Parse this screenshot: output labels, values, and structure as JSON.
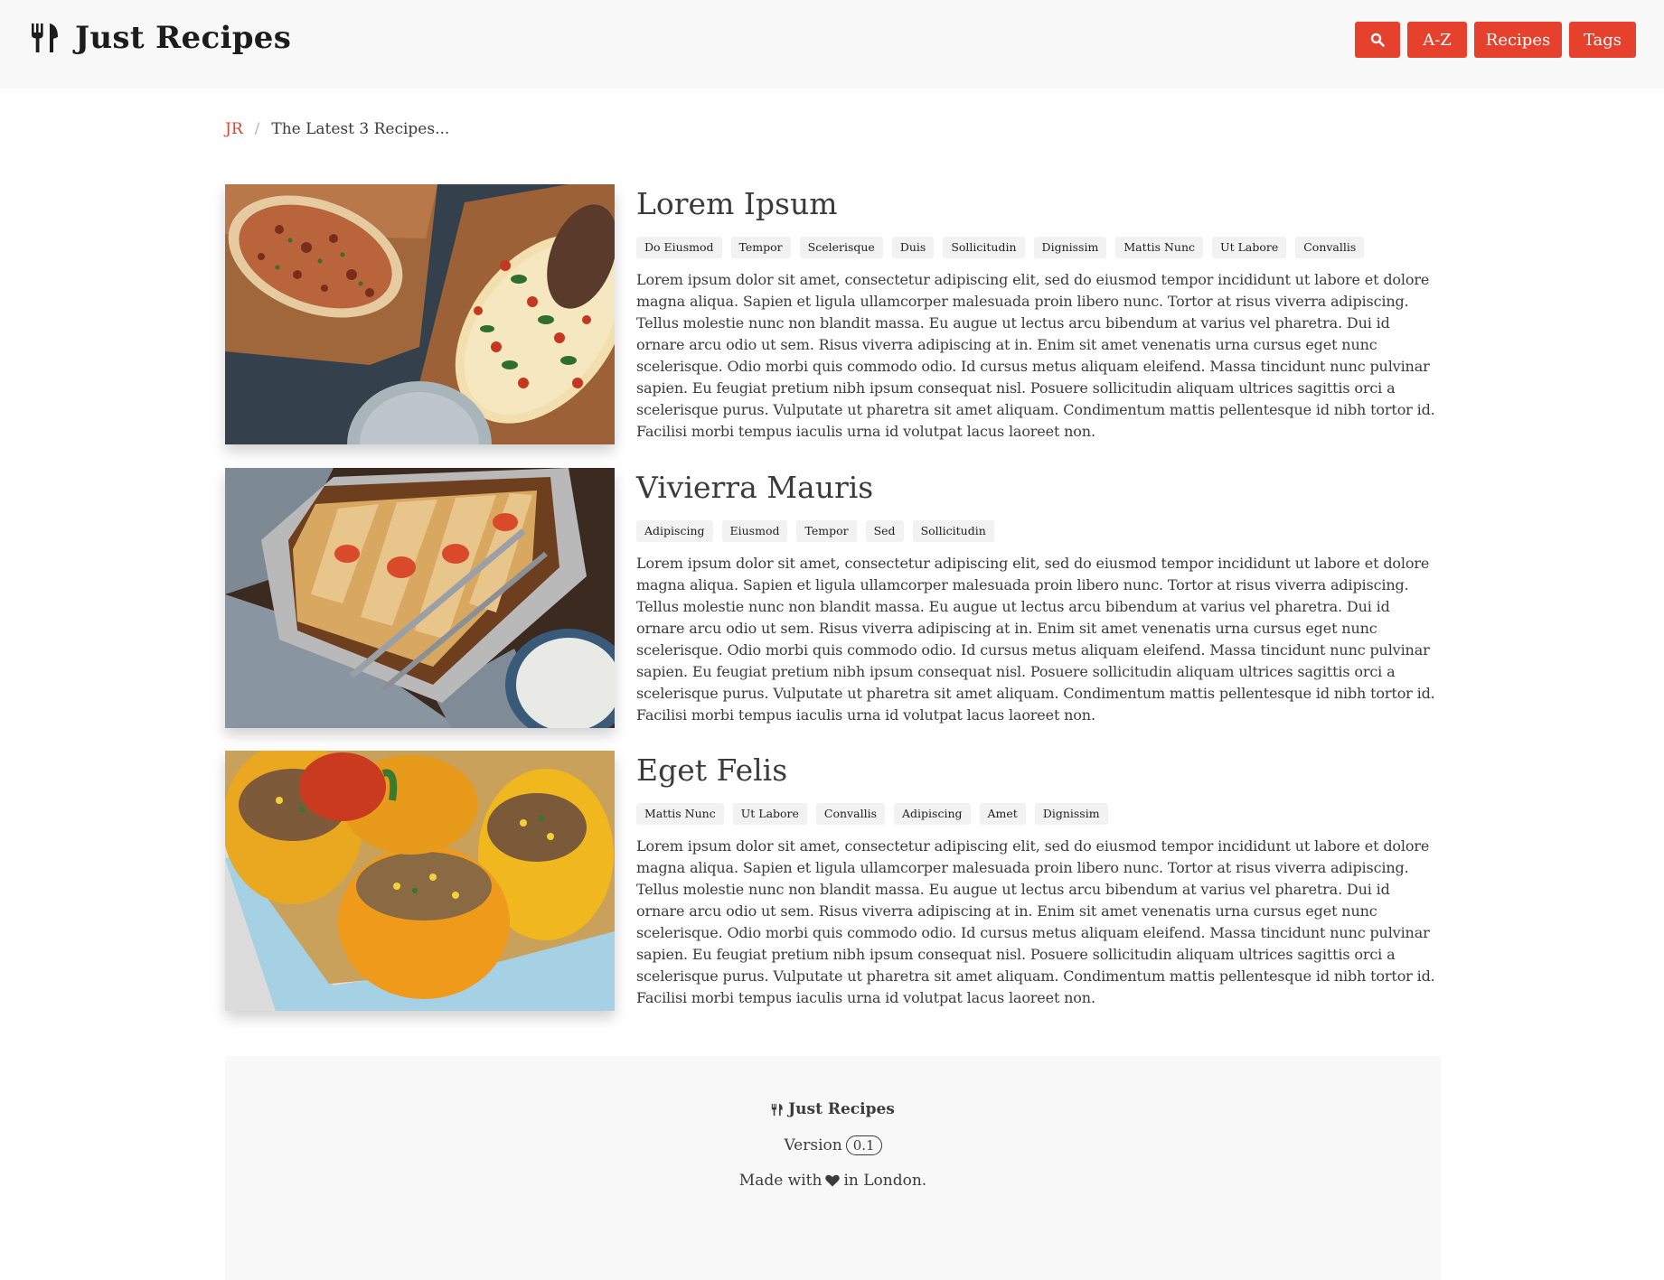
{
  "header": {
    "title": "Just Recipes",
    "icon": "utensils-icon",
    "nav": {
      "search_icon": "search-icon",
      "az_label": "A-Z",
      "recipes_label": "Recipes",
      "tags_label": "Tags"
    }
  },
  "breadcrumb": {
    "home": "JR",
    "separator": "/",
    "current": "The Latest 3 Recipes..."
  },
  "recipes": [
    {
      "title": "Lorem Ipsum",
      "image": "flatbread-pizza-photo",
      "tags": [
        "Do Eiusmod",
        "Tempor",
        "Scelerisque",
        "Duis",
        "Sollicitudin",
        "Dignissim",
        "Mattis Nunc",
        "Ut Labore",
        "Convallis"
      ],
      "description": "Lorem ipsum dolor sit amet, consectetur adipiscing elit, sed do eiusmod tempor incididunt ut labore et dolore magna aliqua. Sapien et ligula ullamcorper malesuada proin libero nunc. Tortor at risus viverra adipiscing. Tellus molestie nunc non blandit massa. Eu augue ut lectus arcu bibendum at varius vel pharetra. Dui id ornare arcu odio ut sem. Risus viverra adipiscing at in. Enim sit amet venenatis urna cursus eget nunc scelerisque. Odio morbi quis commodo odio. Id cursus metus aliquam eleifend. Massa tincidunt nunc pulvinar sapien. Eu feugiat pretium nibh ipsum consequat nisl. Posuere sollicitudin aliquam ultrices sagittis orci a scelerisque purus. Vulputate ut pharetra sit amet aliquam. Condimentum mattis pellentesque id nibh tortor id. Facilisi morbi tempus iaculis urna id volutpat lacus laoreet non."
    },
    {
      "title": "Vivierra Mauris",
      "image": "focaccia-photo",
      "tags": [
        "Adipiscing",
        "Eiusmod",
        "Tempor",
        "Sed",
        "Sollicitudin"
      ],
      "description": "Lorem ipsum dolor sit amet, consectetur adipiscing elit, sed do eiusmod tempor incididunt ut labore et dolore magna aliqua. Sapien et ligula ullamcorper malesuada proin libero nunc. Tortor at risus viverra adipiscing. Tellus molestie nunc non blandit massa. Eu augue ut lectus arcu bibendum at varius vel pharetra. Dui id ornare arcu odio ut sem. Risus viverra adipiscing at in. Enim sit amet venenatis urna cursus eget nunc scelerisque. Odio morbi quis commodo odio. Id cursus metus aliquam eleifend. Massa tincidunt nunc pulvinar sapien. Eu feugiat pretium nibh ipsum consequat nisl. Posuere sollicitudin aliquam ultrices sagittis orci a scelerisque purus. Vulputate ut pharetra sit amet aliquam. Condimentum mattis pellentesque id nibh tortor id. Facilisi morbi tempus iaculis urna id volutpat lacus laoreet non."
    },
    {
      "title": "Eget Felis",
      "image": "stuffed-peppers-photo",
      "tags": [
        "Mattis Nunc",
        "Ut Labore",
        "Convallis",
        "Adipiscing",
        "Amet",
        "Dignissim"
      ],
      "description": "Lorem ipsum dolor sit amet, consectetur adipiscing elit, sed do eiusmod tempor incididunt ut labore et dolore magna aliqua. Sapien et ligula ullamcorper malesuada proin libero nunc. Tortor at risus viverra adipiscing. Tellus molestie nunc non blandit massa. Eu augue ut lectus arcu bibendum at varius vel pharetra. Dui id ornare arcu odio ut sem. Risus viverra adipiscing at in. Enim sit amet venenatis urna cursus eget nunc scelerisque. Odio morbi quis commodo odio. Id cursus metus aliquam eleifend. Massa tincidunt nunc pulvinar sapien. Eu feugiat pretium nibh ipsum consequat nisl. Posuere sollicitudin aliquam ultrices sagittis orci a scelerisque purus. Vulputate ut pharetra sit amet aliquam. Condimentum mattis pellentesque id nibh tortor id. Facilisi morbi tempus iaculis urna id volutpat lacus laoreet non."
    }
  ],
  "footer": {
    "brand": "Just Recipes",
    "version_label": "Version",
    "version": "0.1",
    "made_prefix": "Made with",
    "made_suffix": "in London."
  },
  "colors": {
    "accent": "#e5412d",
    "nav_bg": "#f8f8f8",
    "tag_bg": "#f2f2f2",
    "text": "#3b3b3b"
  }
}
